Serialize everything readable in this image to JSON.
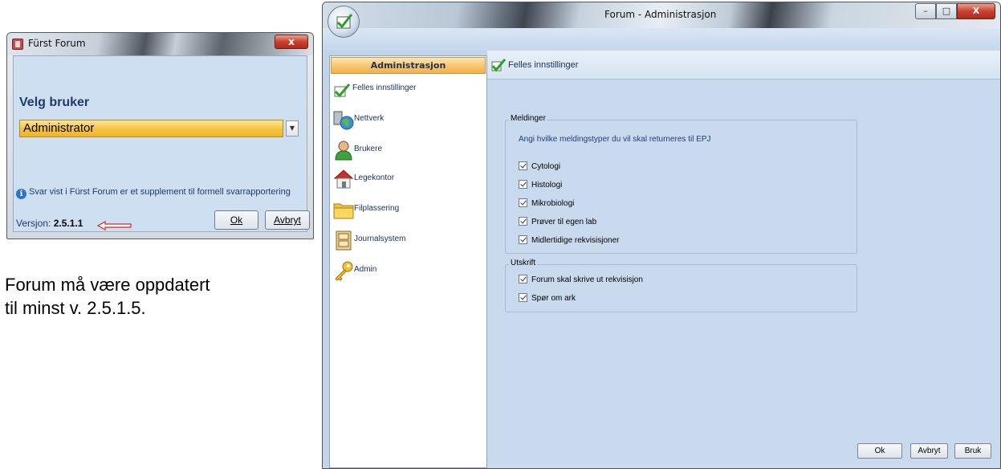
{
  "login_dialog": {
    "title": "Fürst Forum",
    "close_label": "x",
    "heading": "Velg bruker",
    "selected_user": "Administrator",
    "info_text": "Svar vist i Fürst Forum er et supplement til formell svarrapportering",
    "version_label": "Versjon:",
    "version_value": "2.5.1.1",
    "ok_label": "Ok",
    "cancel_label": "Avbryt"
  },
  "caption": {
    "line1": "Forum må være oppdatert",
    "line2": "til minst v. 2.5.1.5."
  },
  "admin_window": {
    "title": "Forum - Administrasjon",
    "nav_header": "Administrasjon",
    "nav_items": [
      {
        "label": "Felles innstillinger",
        "icon": "checkmark-icon"
      },
      {
        "label": "Nettverk",
        "icon": "network-icon"
      },
      {
        "label": "Brukere",
        "icon": "user-icon"
      },
      {
        "label": "Legekontor",
        "icon": "house-icon"
      },
      {
        "label": "Filplassering",
        "icon": "folder-icon"
      },
      {
        "label": "Journalsystem",
        "icon": "cabinet-icon"
      },
      {
        "label": "Admin",
        "icon": "key-icon"
      }
    ],
    "panel_title": "Felles innstillinger",
    "meldinger": {
      "legend": "Meldinger",
      "description": "Angi hvilke meldingstyper du vil skal returneres til EPJ",
      "options": [
        {
          "label": "Cytologi",
          "checked": true
        },
        {
          "label": "Histologi",
          "checked": true
        },
        {
          "label": "Mikrobiologi",
          "checked": true
        },
        {
          "label": "Prøver til egen lab",
          "checked": true
        },
        {
          "label": "Midlertidige rekvisisjoner",
          "checked": true
        }
      ]
    },
    "utskrift": {
      "legend": "Utskrift",
      "options": [
        {
          "label": "Forum skal skrive ut rekvisisjon",
          "checked": true
        },
        {
          "label": "Spør om ark",
          "checked": true
        }
      ]
    },
    "buttons": {
      "ok": "Ok",
      "cancel": "Avbryt",
      "apply": "Bruk"
    }
  },
  "colors": {
    "accent_orange": "#f4c23f",
    "panel_blue": "#c9daef",
    "text_navy": "#1c2f55"
  }
}
